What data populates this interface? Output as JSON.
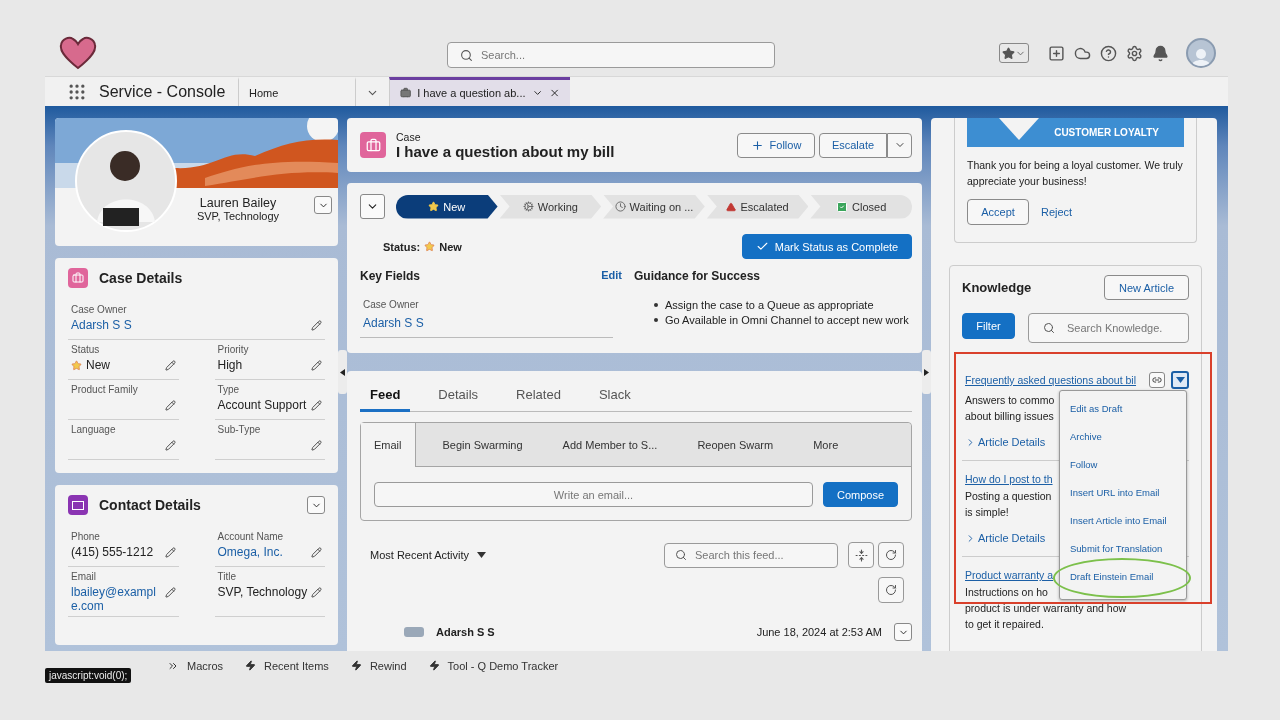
{
  "header": {
    "search_placeholder": "Search..."
  },
  "nav": {
    "app_name": "Service - Console",
    "tabs": [
      {
        "label": "Home",
        "kind": "home",
        "selected": false
      },
      {
        "label": "I have a question ab...",
        "kind": "record",
        "selected": true
      }
    ]
  },
  "profile": {
    "name": "Lauren Bailey",
    "title": "SVP, Technology"
  },
  "case_details": {
    "title": "Case Details",
    "fields": [
      {
        "label": "Case Owner",
        "value": "Adarsh S S",
        "kind": "link",
        "wide": true
      },
      {
        "label": "Status",
        "value": "New",
        "kind": "status"
      },
      {
        "label": "Priority",
        "value": "High",
        "kind": "text"
      },
      {
        "label": "Product Family"
      },
      {
        "label": "Type",
        "value": "Account Support",
        "kind": "text"
      },
      {
        "label": "Language"
      },
      {
        "label": "Sub-Type"
      }
    ]
  },
  "contact_details": {
    "title": "Contact Details",
    "fields": [
      {
        "label": "Phone",
        "value": "(415) 555-1212",
        "kind": "text"
      },
      {
        "label": "Account Name",
        "value": "Omega, Inc.",
        "kind": "link"
      },
      {
        "label": "Email",
        "value": "lbailey@example.com",
        "kind": "link"
      },
      {
        "label": "Title",
        "value": "SVP, Technology",
        "kind": "text"
      }
    ]
  },
  "case": {
    "object": "Case",
    "title": "I have a question about my bill",
    "follow": "Follow",
    "escalate": "Escalate"
  },
  "path": {
    "stages": [
      {
        "label": "New",
        "selected": true
      },
      {
        "label": "Working",
        "selected": false
      },
      {
        "label": "Waiting on ...",
        "selected": false
      },
      {
        "label": "Escalated",
        "selected": false
      },
      {
        "label": "Closed",
        "selected": false
      }
    ],
    "status_label": "Status:",
    "status_value": "New",
    "complete_button": "Mark Status as Complete",
    "key_fields": {
      "title": "Key Fields",
      "edit": "Edit",
      "fields": [
        {
          "label": "Case Owner",
          "value": "Adarsh S S"
        }
      ]
    },
    "guidance": {
      "title": "Guidance for Success",
      "bullets": [
        "Assign the case to a Queue as appropriate",
        "Go Available in Omni Channel to accept new work"
      ]
    }
  },
  "feed": {
    "tabs": [
      {
        "label": "Feed",
        "selected": true
      },
      {
        "label": "Details",
        "selected": false
      },
      {
        "label": "Related",
        "selected": false
      },
      {
        "label": "Slack",
        "selected": false
      }
    ],
    "publisher_tabs": [
      {
        "label": "Email",
        "selected": true
      },
      {
        "label": "Begin Swarming",
        "selected": false
      },
      {
        "label": "Add Member to S...",
        "selected": false
      },
      {
        "label": "Reopen Swarm",
        "selected": false
      },
      {
        "label": "More",
        "selected": false
      }
    ],
    "email_placeholder": "Write an email...",
    "compose": "Compose",
    "sort": "Most Recent Activity",
    "search_placeholder": "Search this feed...",
    "items": [
      {
        "author": "Adarsh S S",
        "time": "June 18, 2024 at 2:53 AM"
      }
    ]
  },
  "loyalty": {
    "banner": "CUSTOMER LOYALTY",
    "message": "Thank you for being a loyal customer. We truly appreciate your business!",
    "accept": "Accept",
    "reject": "Reject"
  },
  "knowledge": {
    "title": "Knowledge",
    "new_article": "New Article",
    "filter": "Filter",
    "search_placeholder": "Search Knowledge.",
    "articles": [
      {
        "title": "Frequently asked questions about bil",
        "description_lines": [
          "Answers to commo",
          "about billing issues"
        ],
        "details": "Article Details",
        "menu_open": true
      },
      {
        "title": "How do I post to th",
        "description_lines": [
          "Posting a question",
          "is simple!"
        ],
        "details": "Article Details"
      },
      {
        "title": "Product warranty a",
        "description_lines": [
          "Instructions on ho",
          "product is under warranty and how",
          "to get it repaired."
        ]
      }
    ],
    "menu": [
      "Edit as Draft",
      "Archive",
      "Follow",
      "Insert URL into Email",
      "Insert Article into Email",
      "Submit for Translation",
      "Draft Einstein Email"
    ]
  },
  "highlight_box": true,
  "highlight_ellipse": true,
  "utility_bar": {
    "items": [
      {
        "label": "Macros"
      },
      {
        "label": "Recent Items"
      },
      {
        "label": "Rewind"
      },
      {
        "label": "Tool - Q Demo Tracker"
      }
    ]
  },
  "tooltip": "javascript:void(0);"
}
